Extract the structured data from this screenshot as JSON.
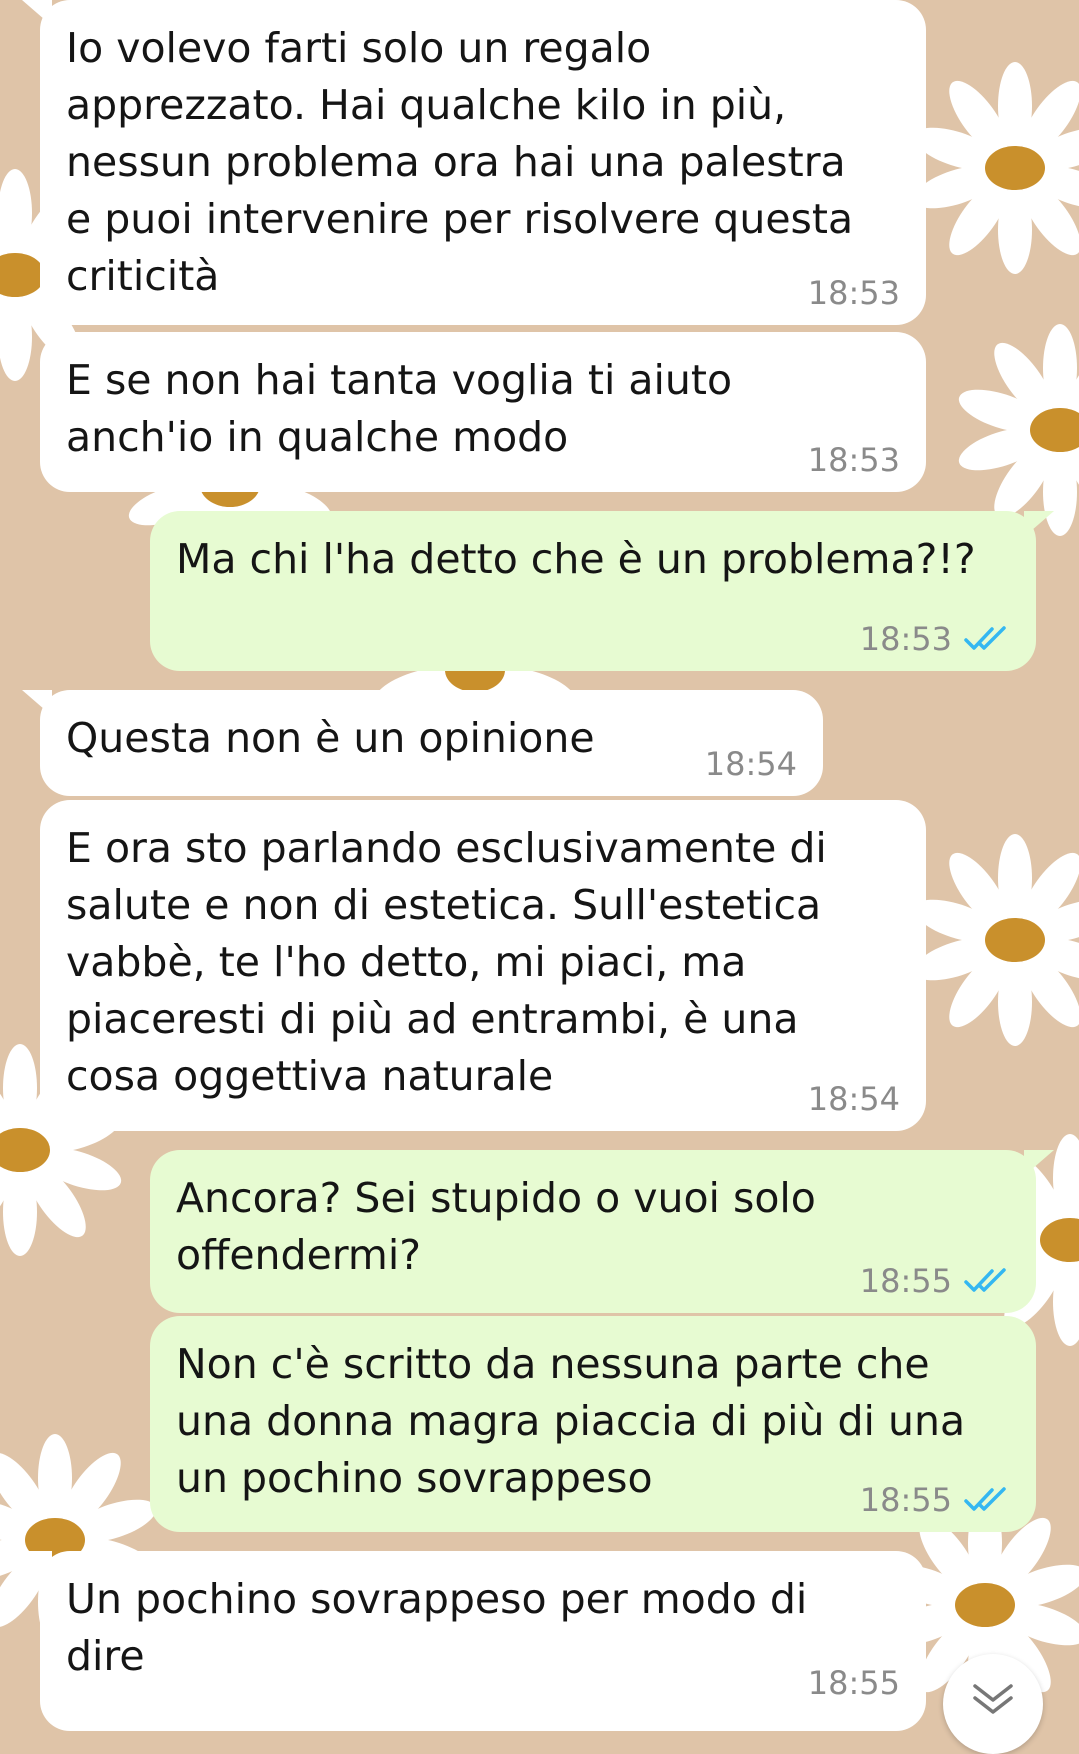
{
  "conversation": {
    "messages": [
      {
        "direction": "incoming",
        "text": "Io volevo farti solo un regalo\napprezzato. Hai qualche kilo in più,\nnessun problema ora hai una palestra\ne puoi intervenire per risolvere questa\ncriticità",
        "time": "18:53"
      },
      {
        "direction": "incoming",
        "text": "E se non hai tanta voglia ti aiuto\nanch'io in qualche modo",
        "time": "18:53"
      },
      {
        "direction": "outgoing",
        "text": "Ma chi l'ha detto che è un problema?!?",
        "time": "18:53",
        "status": "read"
      },
      {
        "direction": "incoming",
        "text": "Questa non è un opinione",
        "time": "18:54"
      },
      {
        "direction": "incoming",
        "text": "E ora sto parlando esclusivamente di\nsalute e non di estetica. Sull'estetica\nvabbè, te l'ho detto, mi piaci, ma\npiaceresti di più ad entrambi, è una\ncosa oggettiva naturale",
        "time": "18:54"
      },
      {
        "direction": "outgoing",
        "text": "Ancora? Sei stupido o vuoi solo\noffendermi?",
        "time": "18:55",
        "status": "read"
      },
      {
        "direction": "outgoing",
        "text": "Non c'è scritto da nessuna parte che\nuna donna magra piaccia di più di una\nun pochino sovrappeso",
        "time": "18:55",
        "status": "read"
      },
      {
        "direction": "incoming",
        "text": "Un pochino sovrappeso per modo di\ndire",
        "time": "18:55"
      }
    ]
  },
  "icons": {
    "read_receipt": "double-check-icon",
    "scroll_down": "chevron-double-down-icon"
  },
  "colors": {
    "wallpaper": "#dfc4a8",
    "incoming_bubble": "#ffffff",
    "outgoing_bubble": "#e7fbd2",
    "read_tick": "#34b7f1",
    "timestamp": "#8a8a8a"
  }
}
